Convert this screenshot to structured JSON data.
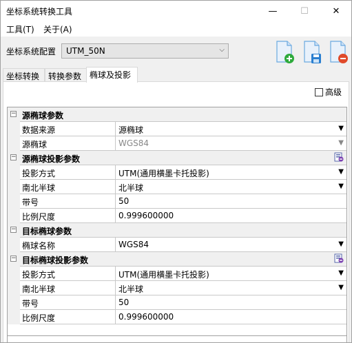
{
  "window": {
    "title": "坐标系统转换工具",
    "min_glyph": "—",
    "max_glyph": "☐",
    "close_glyph": "✕"
  },
  "menu": {
    "tools": "工具(T)",
    "about": "关于(A)"
  },
  "config": {
    "label": "坐标系统配置",
    "selected": "UTM_50N",
    "arrow": "⌵"
  },
  "tabs": [
    "坐标转换",
    "转换参数",
    "椭球及投影"
  ],
  "advanced": {
    "label": "高级",
    "checked": false
  },
  "colors": {
    "accent_green": "#2eaa3c",
    "accent_red": "#e04a2a",
    "save_blue": "#2a7fd0",
    "file_blue": "#6aa9e0"
  },
  "grid": {
    "toggle_glyph": "−",
    "dropdown_glyph": "▼",
    "rows": [
      {
        "type": "category",
        "label": "源椭球参数"
      },
      {
        "type": "prop",
        "name": "数据来源",
        "value": "源椭球",
        "dropdown": true
      },
      {
        "type": "prop",
        "name": "源椭球",
        "value": "WGS84",
        "dropdown": true,
        "gray": true
      },
      {
        "type": "category",
        "label": "源椭球投影参数",
        "icon": "projection-settings-icon"
      },
      {
        "type": "prop",
        "name": "投影方式",
        "value": "UTM(通用横墨卡托投影)",
        "dropdown": true
      },
      {
        "type": "prop",
        "name": "南北半球",
        "value": "北半球",
        "dropdown": true
      },
      {
        "type": "prop",
        "name": "带号",
        "value": "50"
      },
      {
        "type": "prop",
        "name": "比例尺度",
        "value": "0.999600000"
      },
      {
        "type": "category",
        "label": "目标椭球参数"
      },
      {
        "type": "prop",
        "name": "椭球名称",
        "value": "WGS84",
        "dropdown": true
      },
      {
        "type": "category",
        "label": "目标椭球投影参数",
        "icon": "projection-settings-icon"
      },
      {
        "type": "prop",
        "name": "投影方式",
        "value": "UTM(通用横墨卡托投影)",
        "dropdown": true
      },
      {
        "type": "prop",
        "name": "南北半球",
        "value": "北半球",
        "dropdown": true
      },
      {
        "type": "prop",
        "name": "带号",
        "value": "50"
      },
      {
        "type": "prop",
        "name": "比例尺度",
        "value": "0.999600000"
      }
    ]
  }
}
